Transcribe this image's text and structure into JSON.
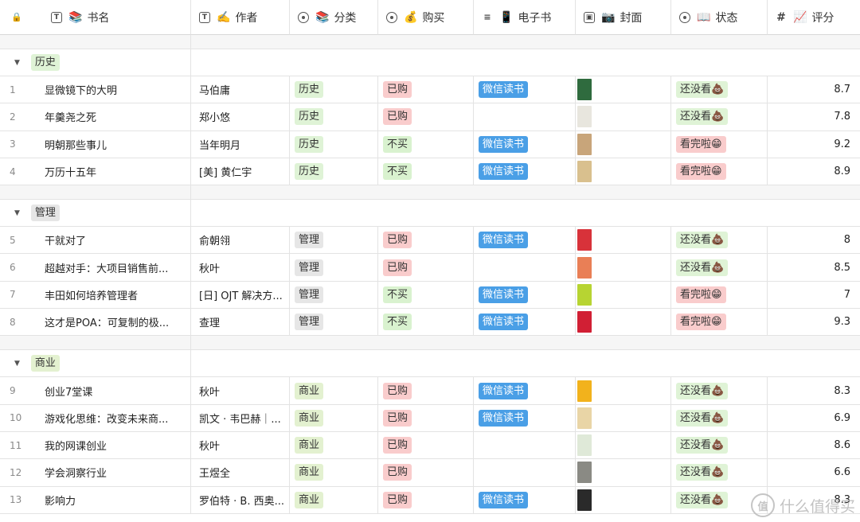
{
  "columns": [
    {
      "icon": "text-field-icon",
      "emoji": "📚",
      "label": "书名"
    },
    {
      "icon": "text-field-icon",
      "emoji": "✍️",
      "label": "作者"
    },
    {
      "icon": "single-select-icon",
      "emoji": "📚",
      "label": "分类"
    },
    {
      "icon": "single-select-icon",
      "emoji": "💰",
      "label": "购买"
    },
    {
      "icon": "multi-select-icon",
      "emoji": "📱",
      "label": "电子书"
    },
    {
      "icon": "attachment-icon",
      "emoji": "📷",
      "label": "封面"
    },
    {
      "icon": "single-select-icon",
      "emoji": "📖",
      "label": "状态"
    },
    {
      "icon": "number-field-icon",
      "emoji": "📈",
      "label": "评分"
    }
  ],
  "tag_colors": {
    "历史": "#dff3d6",
    "管理": "#e6e6e6",
    "商业": "#e3f1d0",
    "已购": "#f9cccc",
    "不买": "#d9f2cf",
    "微信读书": "#4a9fe6",
    "还没看": "#dff3d6",
    "看完啦": "#f9cccc"
  },
  "status_emoji": {
    "还没看": "💩",
    "看完啦": "😁"
  },
  "groups": [
    {
      "name": "历史",
      "rows": [
        {
          "n": "1",
          "title": "显微镜下的大明",
          "author": "马伯庸",
          "cat": "历史",
          "buy": "已购",
          "ebook": "微信读书",
          "cover": "#2f6b3e",
          "status": "还没看",
          "score": "8.7"
        },
        {
          "n": "2",
          "title": "年羹尧之死",
          "author": "郑小悠",
          "cat": "历史",
          "buy": "已购",
          "ebook": "",
          "cover": "#e8e6de",
          "status": "还没看",
          "score": "7.8"
        },
        {
          "n": "3",
          "title": "明朝那些事儿",
          "author": "当年明月",
          "cat": "历史",
          "buy": "不买",
          "ebook": "微信读书",
          "cover": "#c8a57a",
          "status": "看完啦",
          "score": "9.2"
        },
        {
          "n": "4",
          "title": "万历十五年",
          "author": "[美] 黄仁宇",
          "cat": "历史",
          "buy": "不买",
          "ebook": "微信读书",
          "cover": "#d9c08e",
          "status": "看完啦",
          "score": "8.9"
        }
      ]
    },
    {
      "name": "管理",
      "rows": [
        {
          "n": "5",
          "title": "干就对了",
          "author": "俞朝翎",
          "cat": "管理",
          "buy": "已购",
          "ebook": "微信读书",
          "cover": "#d8323a",
          "status": "还没看",
          "score": "8"
        },
        {
          "n": "6",
          "title": "超越对手：大项目销售前...",
          "author": "秋叶",
          "cat": "管理",
          "buy": "已购",
          "ebook": "",
          "cover": "#e97f56",
          "status": "还没看",
          "score": "8.5"
        },
        {
          "n": "7",
          "title": "丰田如何培养管理者",
          "author": "[日] OJT 解决方...",
          "cat": "管理",
          "buy": "不买",
          "ebook": "微信读书",
          "cover": "#b7d432",
          "status": "看完啦",
          "score": "7"
        },
        {
          "n": "8",
          "title": "这才是POA：可复制的极...",
          "author": "查理",
          "cat": "管理",
          "buy": "不买",
          "ebook": "微信读书",
          "cover": "#d11f34",
          "status": "看完啦",
          "score": "9.3"
        }
      ]
    },
    {
      "name": "商业",
      "rows": [
        {
          "n": "9",
          "title": "创业7堂课",
          "author": "秋叶",
          "cat": "商业",
          "buy": "已购",
          "ebook": "微信读书",
          "cover": "#f2b21c",
          "status": "还没看",
          "score": "8.3"
        },
        {
          "n": "10",
          "title": "游戏化思维：改变未来商...",
          "author": "凯文 · 韦巴赫｜...",
          "cat": "商业",
          "buy": "已购",
          "ebook": "微信读书",
          "cover": "#e9d5a6",
          "status": "还没看",
          "score": "6.9"
        },
        {
          "n": "11",
          "title": "我的网课创业",
          "author": "秋叶",
          "cat": "商业",
          "buy": "已购",
          "ebook": "",
          "cover": "#dfe9d8",
          "status": "还没看",
          "score": "8.6"
        },
        {
          "n": "12",
          "title": "学会洞察行业",
          "author": "王煜全",
          "cat": "商业",
          "buy": "已购",
          "ebook": "",
          "cover": "#8a8a84",
          "status": "还没看",
          "score": "6.6"
        },
        {
          "n": "13",
          "title": "影响力",
          "author": "罗伯特 · B. 西奥...",
          "cat": "商业",
          "buy": "已购",
          "ebook": "微信读书",
          "cover": "#2a2a2a",
          "status": "还没看",
          "score": "8.3"
        }
      ]
    }
  ],
  "watermark": "什么值得买"
}
